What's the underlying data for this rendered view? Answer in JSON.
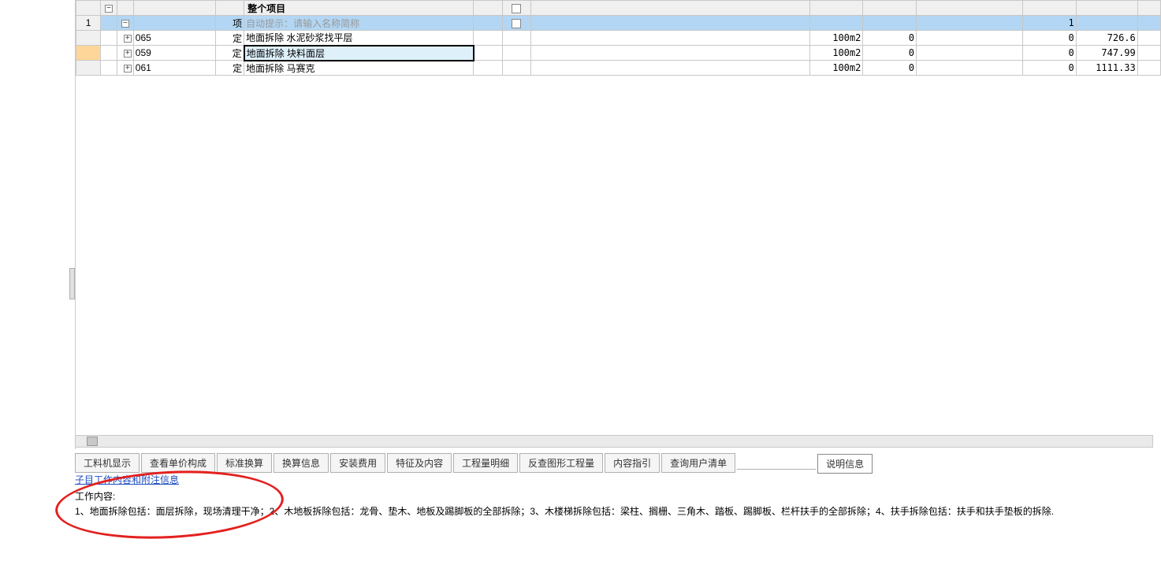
{
  "header": {
    "project_label": "整个项目"
  },
  "rows": [
    {
      "rownum": "",
      "toggle1": "−",
      "toggle2": "",
      "code": "",
      "type": "",
      "name": "整个项目",
      "unit": "",
      "qty": "",
      "qty2": "",
      "price": "",
      "is_header": true
    },
    {
      "rownum": "1",
      "toggle1": "",
      "toggle2": "−",
      "code": "",
      "type": "项",
      "name_placeholder": "自动提示：请输入名称简称",
      "unit": "",
      "qty": "",
      "qty2": "1",
      "price": "",
      "is_blue": true
    },
    {
      "rownum": "",
      "toggle1": "",
      "toggle2": "",
      "expand": "+",
      "code": "065",
      "type": "定",
      "name": "地面拆除 水泥砂浆找平层",
      "unit": "100m2",
      "qty": "0",
      "qty2": "0",
      "price": "726.6"
    },
    {
      "rownum": "",
      "toggle1": "",
      "toggle2": "",
      "expand": "+",
      "code": "059",
      "type": "定",
      "name": "地面拆除 块料面层",
      "unit": "100m2",
      "qty": "0",
      "qty2": "0",
      "price": "747.99",
      "editing": true,
      "selected_orange": true
    },
    {
      "rownum": "",
      "toggle1": "",
      "toggle2": "",
      "expand": "+",
      "code": "061",
      "type": "定",
      "name": "地面拆除 马赛克",
      "unit": "100m2",
      "qty": "0",
      "qty2": "0",
      "price": "1111.33"
    }
  ],
  "tabs": {
    "items": [
      "工料机显示",
      "查看单价构成",
      "标准换算",
      "换算信息",
      "安装费用",
      "特征及内容",
      "工程量明细",
      "反查图形工程量",
      "内容指引",
      "查询用户清单"
    ],
    "active": "说明信息"
  },
  "info": {
    "link": "子目工作内容和附注信息",
    "title": "工作内容:",
    "body": "1、地面拆除包括：面层拆除，现场清理干净；2、木地板拆除包括：龙骨、垫木、地板及踢脚板的全部拆除；3、木楼梯拆除包括：梁柱、搁栅、三角木、踏板、踢脚板、栏杆扶手的全部拆除；4、扶手拆除包括：扶手和扶手垫板的拆除."
  }
}
